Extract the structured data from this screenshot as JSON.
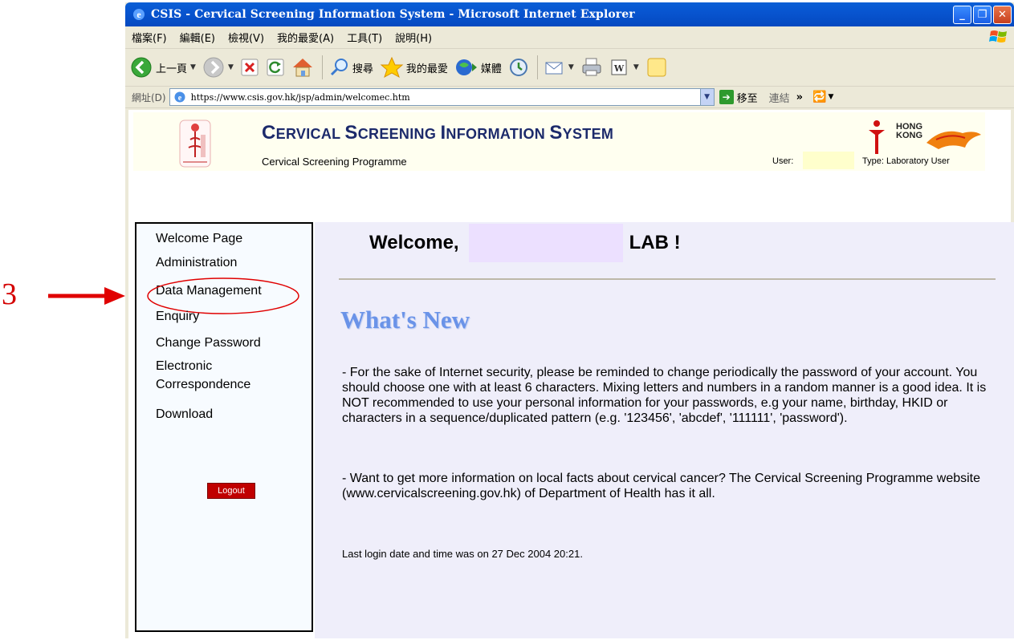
{
  "window": {
    "title": "CSIS - Cervical Screening Information System - Microsoft Internet Explorer",
    "controls": [
      "minimize",
      "restore",
      "close"
    ]
  },
  "menubar": {
    "items": [
      "檔案(F)",
      "編輯(E)",
      "檢視(V)",
      "我的最愛(A)",
      "工具(T)",
      "說明(H)"
    ]
  },
  "toolbar": {
    "back_label": "上一頁",
    "search_label": "搜尋",
    "favorites_label": "我的最愛",
    "media_label": "媒體",
    "icons": [
      "back-icon",
      "forward-icon",
      "stop-icon",
      "refresh-icon",
      "home-icon",
      "search-icon",
      "favorites-icon",
      "media-icon",
      "history-icon",
      "mail-icon",
      "print-icon",
      "word-icon",
      "folder-icon"
    ]
  },
  "addressbar": {
    "label": "網址(D)",
    "url": "https://www.csis.gov.hk/jsp/admin/welcomec.htm",
    "go_label": "移至",
    "links_label": "連結",
    "links_chevron": "»"
  },
  "header": {
    "title_caps": [
      "C",
      "S",
      "I",
      "S"
    ],
    "title_rest": [
      "ERVICAL ",
      "CREENING ",
      "NFORMATION ",
      "YSTEM"
    ],
    "programme": "Cervical Screening Programme",
    "user_label": "User:",
    "user_value": "",
    "type_label": "Type: Laboratory User",
    "hk_logo_text": [
      "HONG",
      "KONG"
    ]
  },
  "sidebar": {
    "items": [
      {
        "label": "Welcome Page"
      },
      {
        "label": "Administration"
      },
      {
        "label": "Data Management"
      },
      {
        "label": "Enquiry"
      },
      {
        "label": "Change Password"
      },
      {
        "label": "Electronic"
      },
      {
        "label": "Correspondence"
      },
      {
        "label": "Download"
      }
    ],
    "logout_label": "Logout"
  },
  "main": {
    "welcome_prefix": "Welcome,",
    "welcome_name": "",
    "welcome_suffix": "LAB !",
    "whats_new": "What's New",
    "paragraph_1": "- For the sake of Internet security, please be reminded to change periodically the password of your account. You should choose one with at least 6 characters. Mixing letters and numbers in a random manner is a good idea. It is NOT recommended to use your personal information for your passwords, e.g your name, birthday, HKID or characters in a sequence/duplicated pattern (e.g. '123456', 'abcdef', '111111', 'password').",
    "paragraph_2": "- Want to get more information on local facts about cervical cancer? The Cervical Screening Programme website (www.cervicalscreening.gov.hk) of Department of Health has it all.",
    "last_login": "Last login date and time was on 27 Dec 2004 20:21."
  },
  "annotation": {
    "number": "3",
    "color": "#d40000"
  }
}
